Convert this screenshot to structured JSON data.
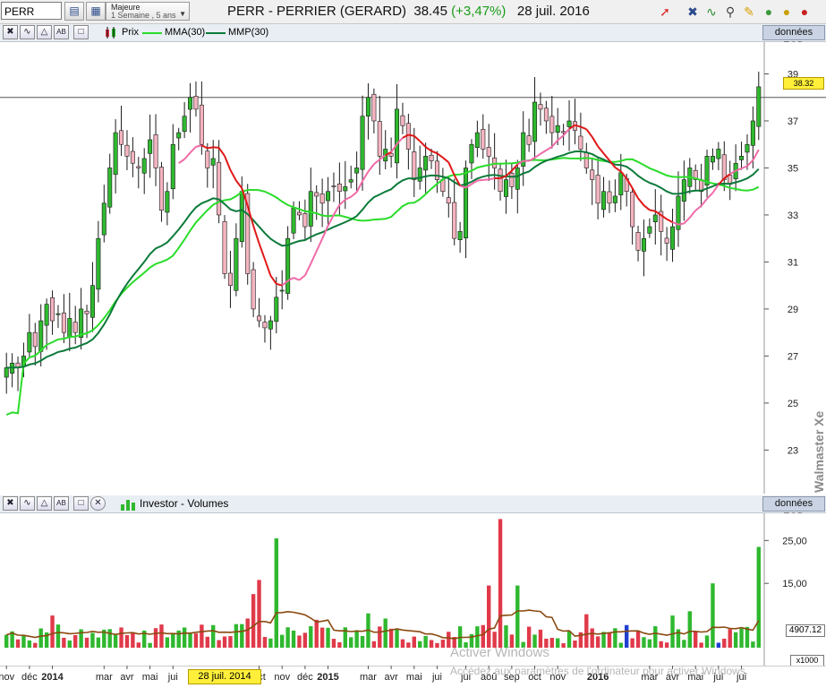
{
  "toolbar": {
    "symbol": "PERR",
    "period_line1": "Majeure",
    "period_line2": "1 Semaine , 5 ans",
    "title_name": "PERR - PERRIER (GERARD)",
    "title_price": "38.45",
    "title_change": "(+3,47%)",
    "title_date": "28 juil. 2016"
  },
  "price_panel": {
    "legend_prix": "Prix",
    "legend_mma": "MMA(30)",
    "legend_mmp": "MMP(30)",
    "eod_label": "données EOD",
    "last_price_tag": "38.32",
    "vertical_label": "Walmaster Xe"
  },
  "volume_panel": {
    "legend": "Investor - Volumes",
    "eod_label": "données EOD",
    "last_volume_tag": "4907.12",
    "unit_label": "x1000"
  },
  "xaxis": {
    "selected_date": "28 juil. 2014"
  },
  "watermark": {
    "line1": "Activer Windows",
    "line2": "Accédez aux paramètres de l'ordinateur pour activer Windows."
  },
  "colors": {
    "up": "#2fb82f",
    "down": "#e03a4a",
    "mma_light": "#2adc2a",
    "mmp_dark": "#0c7a3a",
    "ma_red": "#e01818",
    "ma_pink": "#f06aa8",
    "volume_avg": "#8a4a10"
  },
  "chart_data": [
    {
      "type": "candlestick",
      "title": "",
      "y_ticks": [
        23,
        25,
        27,
        29,
        31,
        33,
        35,
        37,
        39
      ],
      "ylim": [
        21.3,
        40.2
      ],
      "x_tick_labels": [
        {
          "label": "nov",
          "week": 0
        },
        {
          "label": "déc",
          "week": 4
        },
        {
          "label": "2014",
          "week": 8
        },
        {
          "label": "mar",
          "week": 17
        },
        {
          "label": "avr",
          "week": 21
        },
        {
          "label": "mai",
          "week": 25
        },
        {
          "label": "jui",
          "week": 29
        },
        {
          "label": "oct",
          "week": 44
        },
        {
          "label": "nov",
          "week": 48
        },
        {
          "label": "déc",
          "week": 52
        },
        {
          "label": "2015",
          "week": 56
        },
        {
          "label": "mar",
          "week": 63
        },
        {
          "label": "avr",
          "week": 67
        },
        {
          "label": "mai",
          "week": 71
        },
        {
          "label": "jui",
          "week": 75
        },
        {
          "label": "jui",
          "week": 80
        },
        {
          "label": "aoû",
          "week": 84
        },
        {
          "label": "sep",
          "week": 88
        },
        {
          "label": "oct",
          "week": 92
        },
        {
          "label": "nov",
          "week": 96
        },
        {
          "label": "2016",
          "week": 103
        },
        {
          "label": "mar",
          "week": 112
        },
        {
          "label": "avr",
          "week": 116
        },
        {
          "label": "mai",
          "week": 120
        },
        {
          "label": "jui",
          "week": 124
        },
        {
          "label": "jui",
          "week": 128
        }
      ],
      "reference_line": 38.0,
      "series_close": [
        26.5,
        26.7,
        26.5,
        27.0,
        28.0,
        27.4,
        28.5,
        29.2,
        28.5,
        28.8,
        28.0,
        28.6,
        28.0,
        29.0,
        28.8,
        30.0,
        32.0,
        33.5,
        35.0,
        36.5,
        36.0,
        35.5,
        35.2,
        35.0,
        35.4,
        36.2,
        35.0,
        33.2,
        34.0,
        36.0,
        36.5,
        37.2,
        38.0,
        37.5,
        36.0,
        35.0,
        35.4,
        33.0,
        30.5,
        30.0,
        32.0,
        34.0,
        30.5,
        29.0,
        28.5,
        28.2,
        28.5,
        29.5,
        29.8,
        32.0,
        33.3,
        33.0,
        32.5,
        34.0,
        33.8,
        33.5,
        34.0,
        34.2,
        34.0,
        34.2,
        34.5,
        35.0,
        37.2,
        38.0,
        37.0,
        35.5,
        35.8,
        35.5,
        37.5,
        36.8,
        35.8,
        34.5,
        35.0,
        35.5,
        35.3,
        34.5,
        34.0,
        33.5,
        32.0,
        32.3,
        35.0,
        36.0,
        36.5,
        35.8,
        35.5,
        35.0,
        34.0,
        34.5,
        34.2,
        35.0,
        36.5,
        36.0,
        37.8,
        37.5,
        37.0,
        36.5,
        36.8,
        36.5,
        37.0,
        36.6,
        35.8,
        35.0,
        34.5,
        33.5,
        34.0,
        33.5,
        33.8,
        34.8,
        34.0,
        32.5,
        31.5,
        32.0,
        32.5,
        33.0,
        32.3,
        31.8,
        32.5,
        33.8,
        34.5,
        35.0,
        34.5,
        34.0,
        35.5,
        35.5,
        35.8,
        34.5,
        34.3,
        35.2,
        35.5,
        36.0,
        37.0,
        38.45
      ],
      "series": [
        {
          "name": "Prix"
        },
        {
          "name": "MMA(30)"
        },
        {
          "name": "MMP(30)"
        }
      ]
    },
    {
      "type": "bar",
      "title": "Investor - Volumes",
      "y_ticks": [
        15.0,
        25.0
      ],
      "y_tick_labels": [
        "15,00",
        "25,00"
      ],
      "ylim": [
        0,
        30.5
      ],
      "last_value": 4907.12,
      "unit": "x1000"
    }
  ]
}
